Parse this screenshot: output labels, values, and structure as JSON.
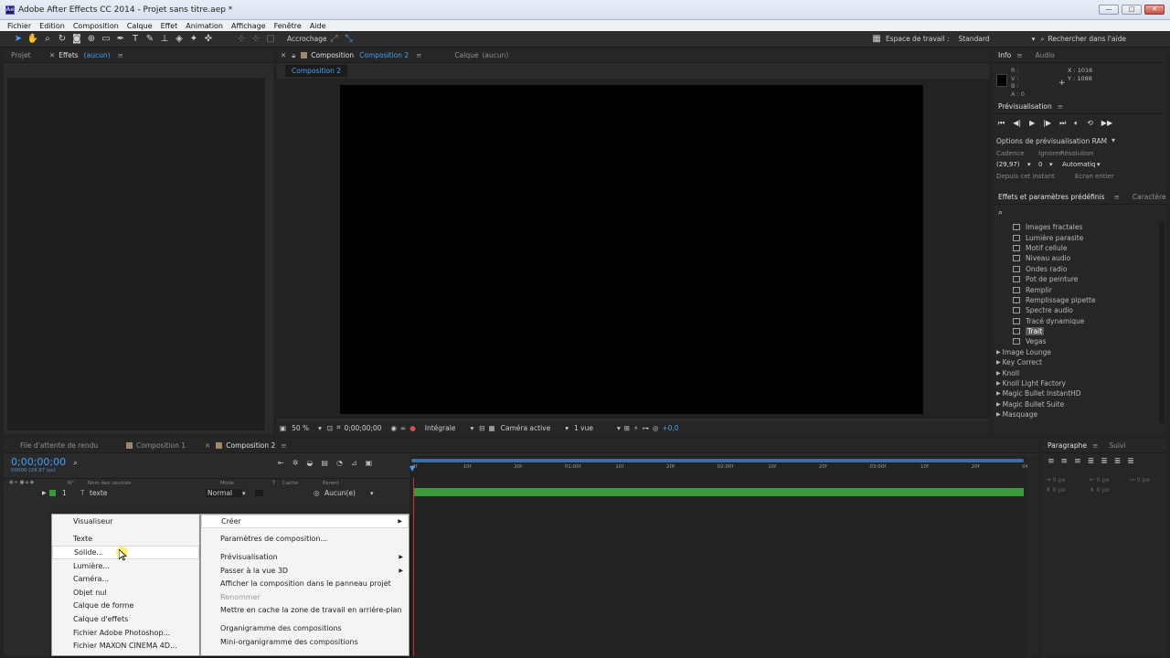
{
  "window": {
    "title": "Adobe After Effects CC 2014 - Projet sans titre.aep *",
    "app_badge": "Ae"
  },
  "menubar": [
    "Fichier",
    "Edition",
    "Composition",
    "Calque",
    "Effet",
    "Animation",
    "Affichage",
    "Fenêtre",
    "Aide"
  ],
  "toolbar": {
    "snap_label": "Accrochage",
    "workspace_label": "Espace de travail :",
    "workspace_value": "Standard",
    "search_help": "Rechercher dans l'aide"
  },
  "left_panel": {
    "tab_project": "Projet",
    "tab_effects": "Effets",
    "effects_target": "(aucun)"
  },
  "comp_panel": {
    "tab_label": "Composition",
    "tab_name": "Composition 2",
    "layer_tab": "Calque",
    "layer_target": "(aucun)",
    "breadcrumb": "Composition 2",
    "zoom": "50 %",
    "timecode": "0;00;00;00",
    "resolution": "Intégrale",
    "camera": "Caméra active",
    "views": "1 vue",
    "exposure": "+0,0"
  },
  "info_panel": {
    "tab_info": "Info",
    "tab_audio": "Audio",
    "r": "R :",
    "v": "V :",
    "b": "B :",
    "a": "A : 0",
    "x": "X : 1016",
    "y": "Y : 1088"
  },
  "preview_panel": {
    "title": "Prévisualisation",
    "ram_options": "Options de prévisualisation RAM",
    "frame_rate_label": "Cadence",
    "skip_label": "Ignorer",
    "resolution_label": "Résolution",
    "frame_rate_value": "(29,97)",
    "skip_value": "0",
    "resolution_value": "Automatiq",
    "from_current": "Depuis cet instant",
    "full_screen": "Ecran entier"
  },
  "effects_presets": {
    "tab_title": "Effets et paramètres prédéfinis",
    "tab_char": "Caractère",
    "search_icon": "magnifier-icon",
    "items": [
      {
        "label": "Images fractales",
        "type": "effect"
      },
      {
        "label": "Lumière parasite",
        "type": "effect"
      },
      {
        "label": "Motif cellule",
        "type": "effect"
      },
      {
        "label": "Niveau audio",
        "type": "effect"
      },
      {
        "label": "Ondes radio",
        "type": "effect"
      },
      {
        "label": "Pot de peinture",
        "type": "effect"
      },
      {
        "label": "Remplir",
        "type": "effect"
      },
      {
        "label": "Remplissage pipette",
        "type": "effect"
      },
      {
        "label": "Spectre audio",
        "type": "effect"
      },
      {
        "label": "Tracé dynamique",
        "type": "effect"
      },
      {
        "label": "Trait",
        "type": "effect",
        "selected": true
      },
      {
        "label": "Vegas",
        "type": "effect"
      },
      {
        "label": "Image Lounge",
        "type": "category"
      },
      {
        "label": "Key Correct",
        "type": "category"
      },
      {
        "label": "Knoll",
        "type": "category"
      },
      {
        "label": "Knoll Light Factory",
        "type": "category"
      },
      {
        "label": "Magic Bullet InstantHD",
        "type": "category"
      },
      {
        "label": "Magic Bullet Suite",
        "type": "category"
      },
      {
        "label": "Masquage",
        "type": "category"
      }
    ]
  },
  "timeline": {
    "tab_render": "File d'attente de rendu",
    "tab_comp1": "Composition 1",
    "tab_comp2": "Composition 2",
    "timecode": "0;00;00;00",
    "fps": "00000 (29,97 ips)",
    "col_num": "N°",
    "col_source": "Nom des sources",
    "col_mode": "Mode",
    "col_t": "T",
    "col_cache": "Cache",
    "col_parent": "Parent",
    "layer": {
      "index": "1",
      "name": "texte",
      "mode": "Normal",
      "parent": "Aucun(e)"
    },
    "ruler": [
      "0f",
      "10f",
      "20f",
      "01:00f",
      "10f",
      "20f",
      "02:00f",
      "10f",
      "20f",
      "03:00f",
      "10f",
      "20f",
      "04:0"
    ],
    "layer_color": "#3a9a3a"
  },
  "paragraph_panel": {
    "tab_para": "Paragraphe",
    "tab_track": "Suivi",
    "px": "0 px"
  },
  "context_menu_left": {
    "items": [
      "Visualiseur",
      "Texte",
      "Solide...",
      "Lumière...",
      "Caméra...",
      "Objet nul",
      "Calque de forme",
      "Calque d'effets",
      "Fichier Adobe Photoshop...",
      "Fichier MAXON CINEMA 4D..."
    ],
    "highlighted": "Solide..."
  },
  "context_menu_right": {
    "items": [
      {
        "label": "Créer",
        "submenu": true,
        "highlight": true
      },
      {
        "label": "Paramètres de composition..."
      },
      {
        "label": "Prévisualisation",
        "submenu": true
      },
      {
        "label": "Passer à la vue 3D",
        "submenu": true
      },
      {
        "label": "Afficher la composition dans le panneau projet"
      },
      {
        "label": "Renommer",
        "disabled": true
      },
      {
        "label": "Mettre en cache la zone de travail en arrière-plan"
      },
      {
        "label": "Organigramme des compositions"
      },
      {
        "label": "Mini-organigramme des compositions"
      }
    ]
  },
  "colors": {
    "accent": "#3ea1ff",
    "bg": "#232323",
    "panel": "#2b2b2b",
    "layer_bar": "#3a9a3a",
    "playhead": "#d03030"
  }
}
